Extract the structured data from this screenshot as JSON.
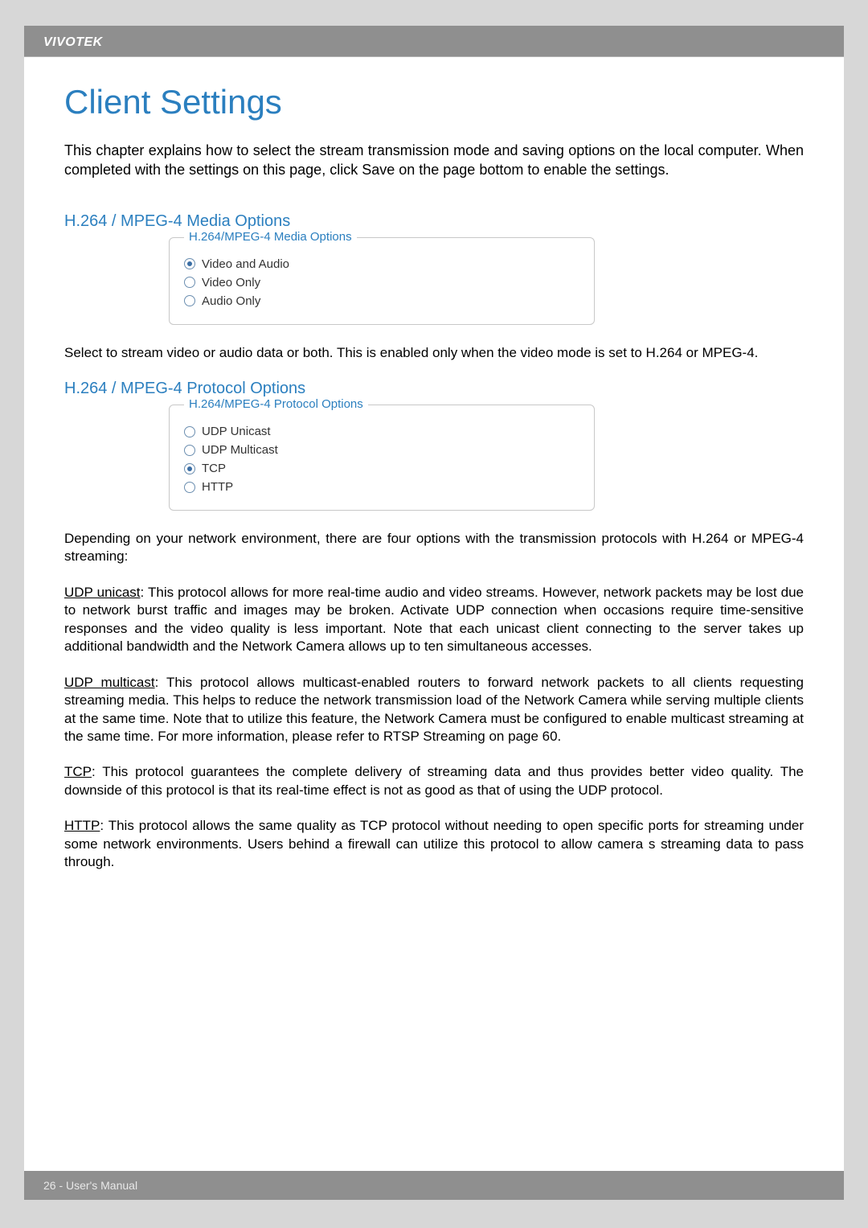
{
  "header": {
    "brand": "VIVOTEK"
  },
  "title": "Client Settings",
  "intro": "This chapter explains how to select the stream transmission mode and saving options on the local computer. When completed with the settings on this page, click Save on the page bottom to enable the settings.",
  "media_section": {
    "heading": "H.264 / MPEG-4 Media Options",
    "legend": "H.264/MPEG-4 Media Options",
    "options": [
      {
        "label": "Video and Audio",
        "selected": true
      },
      {
        "label": "Video Only",
        "selected": false
      },
      {
        "label": "Audio Only",
        "selected": false
      }
    ],
    "note": "Select to stream video or audio data or both. This is enabled only when the video mode is set to H.264 or MPEG-4."
  },
  "protocol_section": {
    "heading": "H.264 / MPEG-4 Protocol Options",
    "legend": "H.264/MPEG-4 Protocol Options",
    "options": [
      {
        "label": "UDP Unicast",
        "selected": false
      },
      {
        "label": "UDP Multicast",
        "selected": false
      },
      {
        "label": "TCP",
        "selected": true
      },
      {
        "label": "HTTP",
        "selected": false
      }
    ],
    "note": "Depending on your network environment, there are four options with the transmission protocols with H.264 or MPEG-4 streaming:"
  },
  "protocol_desc": {
    "udp_unicast": {
      "term": "UDP unicast",
      "body": ": This protocol allows for more real-time audio and video streams. However, network packets may be lost due to network burst traffic and images may be broken. Activate UDP connection when occasions require time-sensitive responses and the video quality is less important. Note that each unicast client connecting to the server takes up additional bandwidth and the Network Camera allows up to ten simultaneous accesses."
    },
    "udp_multicast": {
      "term": "UDP multicast",
      "body": ": This protocol allows multicast-enabled routers to forward network packets to all clients requesting streaming media. This helps to reduce the network transmission load of the Network Camera while serving multiple clients at the same time. Note that to utilize this feature, the Network Camera must be configured to enable multicast streaming at the same time. For more information, please refer to RTSP Streaming on page 60."
    },
    "tcp": {
      "term": "TCP",
      "body": ": This protocol guarantees the complete delivery of streaming data and thus provides better video quality. The downside of this protocol is that its real-time effect is not as good as that of using the UDP protocol."
    },
    "http": {
      "term": "HTTP",
      "body": ": This protocol allows the same quality as TCP protocol without needing to open specific ports for streaming under some network environments. Users behind a firewall can utilize this protocol to allow camera s streaming data to pass through."
    }
  },
  "footer": {
    "text": "26 - User's Manual"
  }
}
